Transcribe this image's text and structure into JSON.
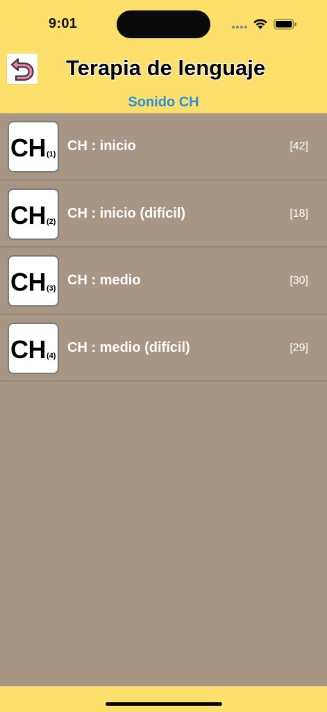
{
  "status_bar": {
    "time": "9:01"
  },
  "header": {
    "title": "Terapia de lenguaje",
    "subtitle": "Sonido CH",
    "accent_color": "#fde06c",
    "back_icon": "undo-arrow-icon"
  },
  "list": {
    "items": [
      {
        "badge": "CH",
        "badge_num": "(1)",
        "label": "CH : inicio",
        "count": "[42]"
      },
      {
        "badge": "CH",
        "badge_num": "(2)",
        "label": "CH : inicio (difícil)",
        "count": "[18]"
      },
      {
        "badge": "CH",
        "badge_num": "(3)",
        "label": "CH : medio",
        "count": "[30]"
      },
      {
        "badge": "CH",
        "badge_num": "(4)",
        "label": "CH : medio (difícil)",
        "count": "[29]"
      }
    ]
  }
}
